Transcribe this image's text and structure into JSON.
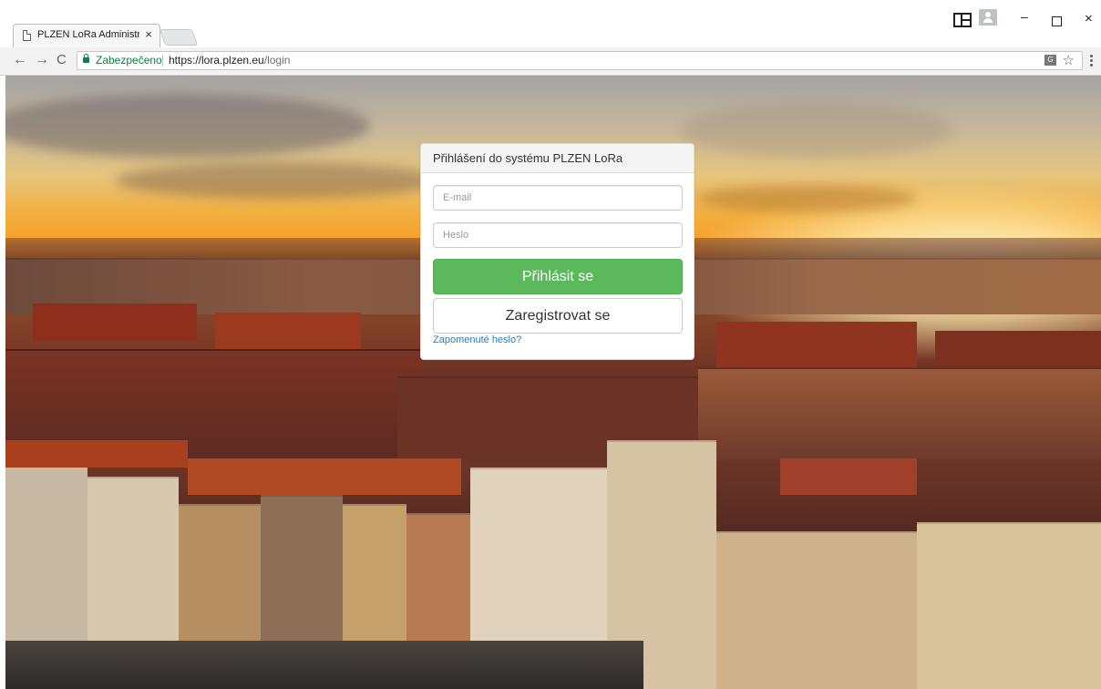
{
  "browser": {
    "tab_title": "PLZEN LoRa Administrac",
    "tab_close": "×",
    "minimize": "–",
    "close": "×",
    "back": "←",
    "forward": "→",
    "reload": "C",
    "security_label": "Zabezpečeno",
    "url_host": "https://lora.plzen.eu",
    "url_path": "/login",
    "bookmark_star": "☆"
  },
  "login": {
    "title": "Přihlášení do systému PLZEN LoRa",
    "email_placeholder": "E-mail",
    "password_placeholder": "Heslo",
    "login_button": "Přihlásit se",
    "register_button": "Zaregistrovat se",
    "forgot_password": "Zapomenuté heslo?"
  },
  "colors": {
    "login_button": "#5cb85c",
    "link": "#337ab7",
    "secure": "#0b8043"
  },
  "icons": {
    "tab": "document-icon",
    "security": "lock-icon",
    "translate": "translate-icon",
    "bookmark": "star-icon",
    "menu": "kebab-menu-icon",
    "window_layout": "layout-icon",
    "profile": "profile-icon"
  }
}
